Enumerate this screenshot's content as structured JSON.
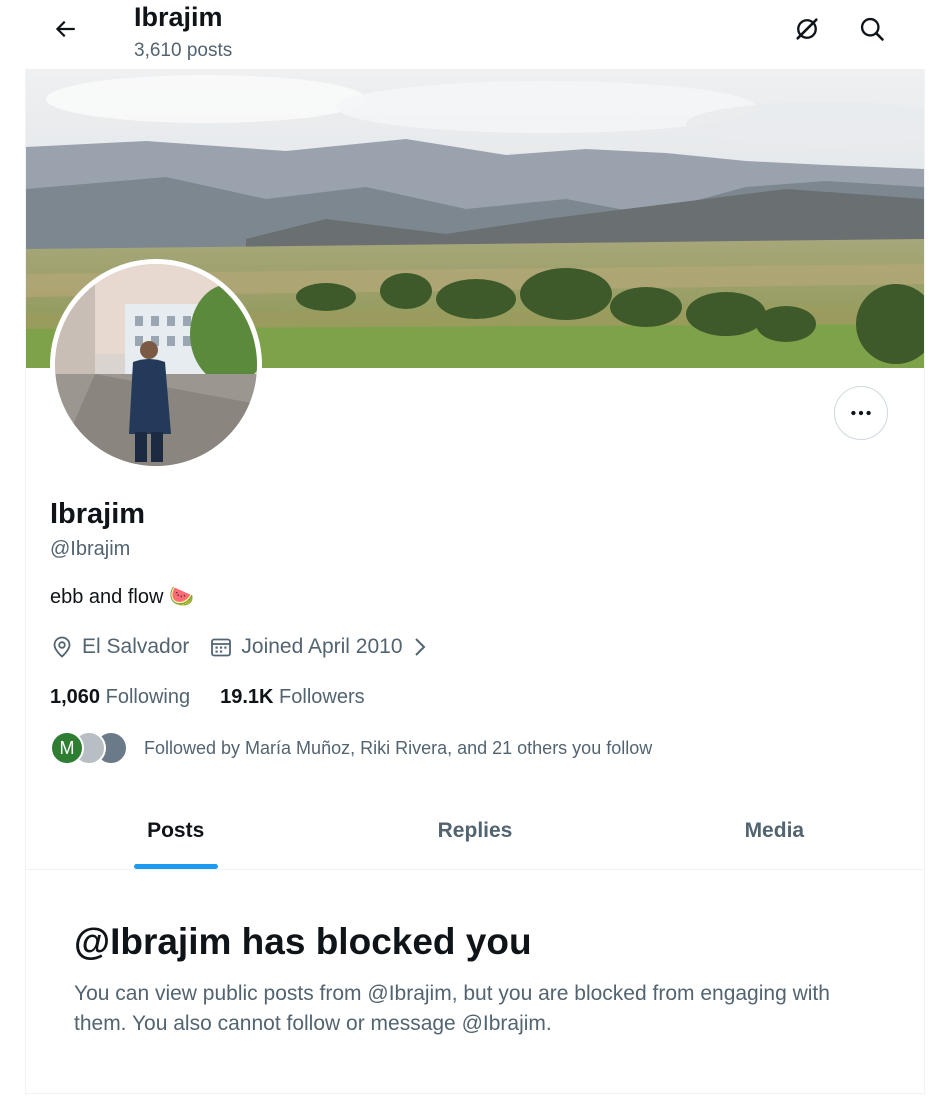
{
  "header": {
    "title": "Ibrajim",
    "posts_count": "3,610 posts",
    "back_icon": "arrow-left-icon",
    "grok_icon": "grok-icon",
    "search_icon": "search-icon"
  },
  "profile": {
    "display_name": "Ibrajim",
    "handle": "@Ibrajim",
    "bio": "ebb and flow",
    "bio_emoji": "🍉",
    "location": "El Salvador",
    "joined": "Joined April 2010",
    "following_count": "1,060",
    "following_label": "Following",
    "followers_count": "19.1K",
    "followers_label": "Followers",
    "followed_by": "Followed by María Muñoz, Riki Rivera, and 21 others you follow",
    "mini_avatar_letter": "M"
  },
  "tabs": [
    {
      "label": "Posts"
    },
    {
      "label": "Replies"
    },
    {
      "label": "Media"
    }
  ],
  "blocked": {
    "title": "@Ibrajim has blocked you",
    "message": "You can view public posts from @Ibrajim, but you are blocked from engaging with them. You also cannot follow or message @Ibrajim."
  },
  "colors": {
    "accent": "#1d9bf0",
    "text": "#0f1419",
    "secondary": "#536471"
  }
}
